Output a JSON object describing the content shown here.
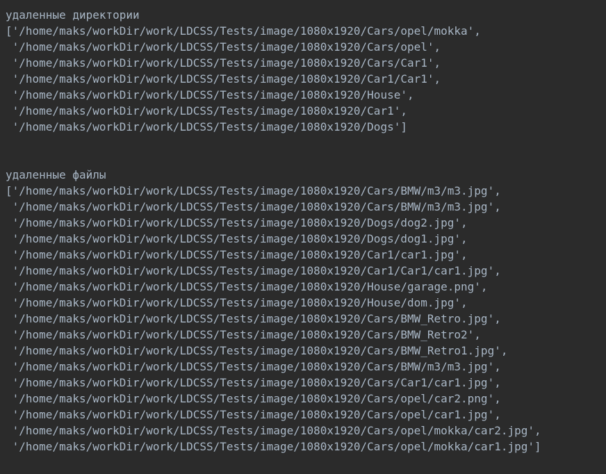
{
  "console": {
    "dirs_header": "удаленные директории",
    "dirs_lines": [
      "['/home/maks/workDir/work/LDCSS/Tests/image/1080x1920/Cars/opel/mokka',",
      " '/home/maks/workDir/work/LDCSS/Tests/image/1080x1920/Cars/opel',",
      " '/home/maks/workDir/work/LDCSS/Tests/image/1080x1920/Cars/Car1',",
      " '/home/maks/workDir/work/LDCSS/Tests/image/1080x1920/Car1/Car1',",
      " '/home/maks/workDir/work/LDCSS/Tests/image/1080x1920/House',",
      " '/home/maks/workDir/work/LDCSS/Tests/image/1080x1920/Car1',",
      " '/home/maks/workDir/work/LDCSS/Tests/image/1080x1920/Dogs']"
    ],
    "files_header": "удаленные файлы",
    "files_lines": [
      "['/home/maks/workDir/work/LDCSS/Tests/image/1080x1920/Cars/BMW/m3/m3.jpg',",
      " '/home/maks/workDir/work/LDCSS/Tests/image/1080x1920/Cars/BMW/m3/m3.jpg',",
      " '/home/maks/workDir/work/LDCSS/Tests/image/1080x1920/Dogs/dog2.jpg',",
      " '/home/maks/workDir/work/LDCSS/Tests/image/1080x1920/Dogs/dog1.jpg',",
      " '/home/maks/workDir/work/LDCSS/Tests/image/1080x1920/Car1/car1.jpg',",
      " '/home/maks/workDir/work/LDCSS/Tests/image/1080x1920/Car1/Car1/car1.jpg',",
      " '/home/maks/workDir/work/LDCSS/Tests/image/1080x1920/House/garage.png',",
      " '/home/maks/workDir/work/LDCSS/Tests/image/1080x1920/House/dom.jpg',",
      " '/home/maks/workDir/work/LDCSS/Tests/image/1080x1920/Cars/BMW_Retro.jpg',",
      " '/home/maks/workDir/work/LDCSS/Tests/image/1080x1920/Cars/BMW_Retro2',",
      " '/home/maks/workDir/work/LDCSS/Tests/image/1080x1920/Cars/BMW_Retro1.jpg',",
      " '/home/maks/workDir/work/LDCSS/Tests/image/1080x1920/Cars/BMW/m3/m3.jpg',",
      " '/home/maks/workDir/work/LDCSS/Tests/image/1080x1920/Cars/Car1/car1.jpg',",
      " '/home/maks/workDir/work/LDCSS/Tests/image/1080x1920/Cars/opel/car2.png',",
      " '/home/maks/workDir/work/LDCSS/Tests/image/1080x1920/Cars/opel/car1.jpg',",
      " '/home/maks/workDir/work/LDCSS/Tests/image/1080x1920/Cars/opel/mokka/car2.jpg',",
      " '/home/maks/workDir/work/LDCSS/Tests/image/1080x1920/Cars/opel/mokka/car1.jpg']"
    ]
  },
  "colors": {
    "background": "#2b2b2b",
    "text": "#a9b7c6"
  }
}
